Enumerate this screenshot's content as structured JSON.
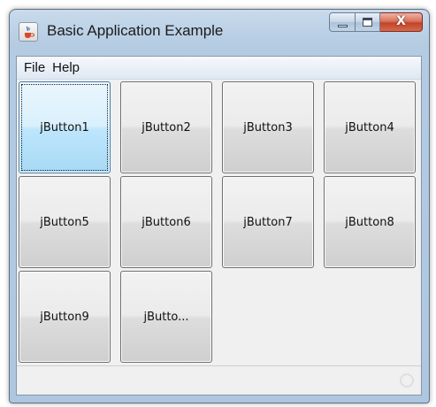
{
  "window": {
    "title": "Basic Application Example",
    "icon": "java-cup-icon",
    "controls": {
      "minimize_icon": "minimize-icon",
      "maximize_icon": "maximize-icon",
      "close_icon": "close-icon",
      "close_glyph": "X"
    }
  },
  "menubar": {
    "items": [
      {
        "label": "File"
      },
      {
        "label": "Help"
      }
    ]
  },
  "buttons": [
    {
      "label": "jButton1",
      "focused": true
    },
    {
      "label": "jButton2"
    },
    {
      "label": "jButton3"
    },
    {
      "label": "jButton4"
    },
    {
      "label": "jButton5"
    },
    {
      "label": "jButton6"
    },
    {
      "label": "jButton7"
    },
    {
      "label": "jButton8"
    },
    {
      "label": "jButton9"
    },
    {
      "label": "jButto..."
    }
  ],
  "statusbar": {
    "busy_icon": "busy-indicator-icon"
  },
  "colors": {
    "frame": "#b4cbe2",
    "close_button": "#c2432b",
    "focused_button": "#bee6fd"
  }
}
